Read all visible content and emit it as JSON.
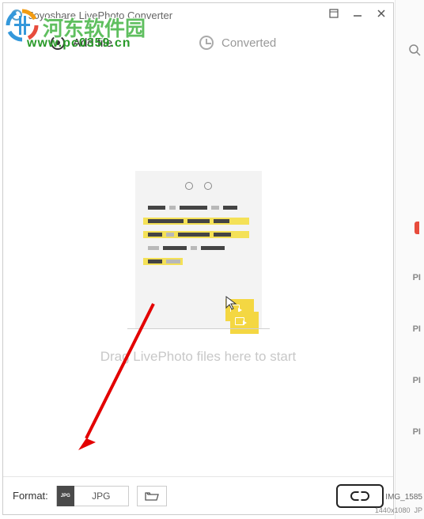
{
  "app": {
    "title": "Joyoshare LivePhoto Converter"
  },
  "tabs": {
    "add": "Add file",
    "converted": "Converted"
  },
  "main": {
    "hint": "Drag LivePhoto files here to start"
  },
  "bottom": {
    "format_label": "Format:",
    "format_badge": "JPG",
    "format_value": "JPG"
  },
  "watermark": {
    "site_name": "河东软件园",
    "site_url": "www.pc0359.cn"
  },
  "side": {
    "filename": "IMG_1585",
    "dimensions": "1440x1080",
    "ext": "JP"
  }
}
